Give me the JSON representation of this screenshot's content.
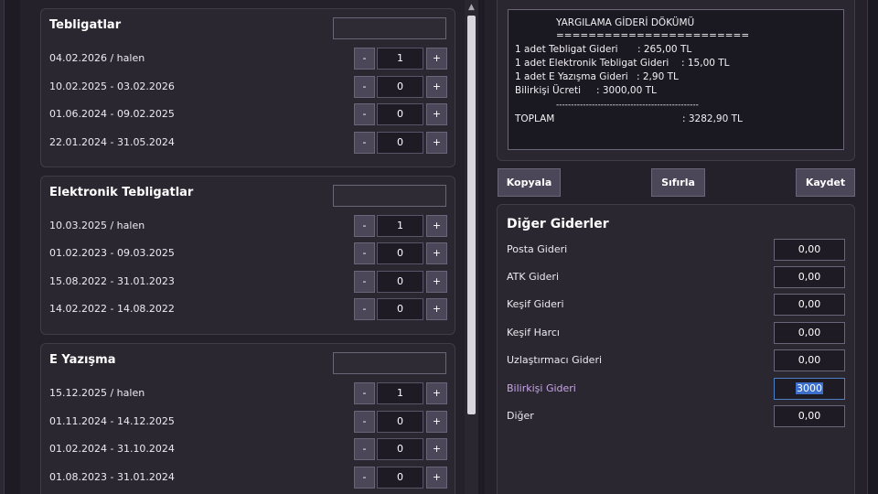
{
  "groups": [
    {
      "title": "Tebligatlar",
      "rows": [
        {
          "label": "04.02.2026 / halen",
          "count": "1"
        },
        {
          "label": "10.02.2025 - 03.02.2026",
          "count": "0"
        },
        {
          "label": "01.06.2024 - 09.02.2025",
          "count": "0"
        },
        {
          "label": "22.01.2024 - 31.05.2024",
          "count": "0"
        }
      ]
    },
    {
      "title": "Elektronik Tebligatlar",
      "rows": [
        {
          "label": "10.03.2025 / halen",
          "count": "1"
        },
        {
          "label": "01.02.2023 - 09.03.2025",
          "count": "0"
        },
        {
          "label": "15.08.2022 - 31.01.2023",
          "count": "0"
        },
        {
          "label": "14.02.2022 - 14.08.2022",
          "count": "0"
        }
      ]
    },
    {
      "title": "E Yazışma",
      "rows": [
        {
          "label": "15.12.2025 / halen",
          "count": "1"
        },
        {
          "label": "01.11.2024 - 14.12.2025",
          "count": "0"
        },
        {
          "label": "01.02.2024 - 31.10.2024",
          "count": "0"
        },
        {
          "label": "01.08.2023 - 31.01.2024",
          "count": "0"
        }
      ]
    }
  ],
  "stepper": {
    "minus": "-",
    "plus": "+"
  },
  "scroll_up_glyph": "▲",
  "dokum": {
    "title": "YARGILAMA GİDERİ DÖKÜMÜ",
    "separator": "========================",
    "lines": [
      {
        "label": "1 adet Tebligat Gideri",
        "value": ": 265,00 TL"
      },
      {
        "label": "1 adet Elektronik Tebligat Gideri",
        "value": ": 15,00 TL"
      },
      {
        "label": "1 adet E Yazışma Gideri",
        "value": ": 2,90 TL"
      },
      {
        "label": "Bilirkişi Ücreti",
        "value": ": 3000,00 TL"
      }
    ],
    "dash_separator": "------------------------------------------------",
    "total_label": "TOPLAM",
    "total_value": ": 3282,90 TL"
  },
  "actions": {
    "copy": "Kopyala",
    "reset": "Sıfırla",
    "save": "Kaydet"
  },
  "other": {
    "title": "Diğer Giderler",
    "items": [
      {
        "label": "Posta Gideri",
        "value": "0,00"
      },
      {
        "label": "ATK Gideri",
        "value": "0,00"
      },
      {
        "label": "Keşif Gideri",
        "value": "0,00"
      },
      {
        "label": "Keşif Harcı",
        "value": "0,00"
      },
      {
        "label": "Uzlaştırmacı Gideri",
        "value": "0,00"
      },
      {
        "label": "Bilirkişi Gideri",
        "value": "3000"
      },
      {
        "label": "Diğer",
        "value": "0,00"
      }
    ]
  },
  "colors": {
    "accent_focus": "#c8a6ea",
    "selection": "#3b6fcb"
  }
}
